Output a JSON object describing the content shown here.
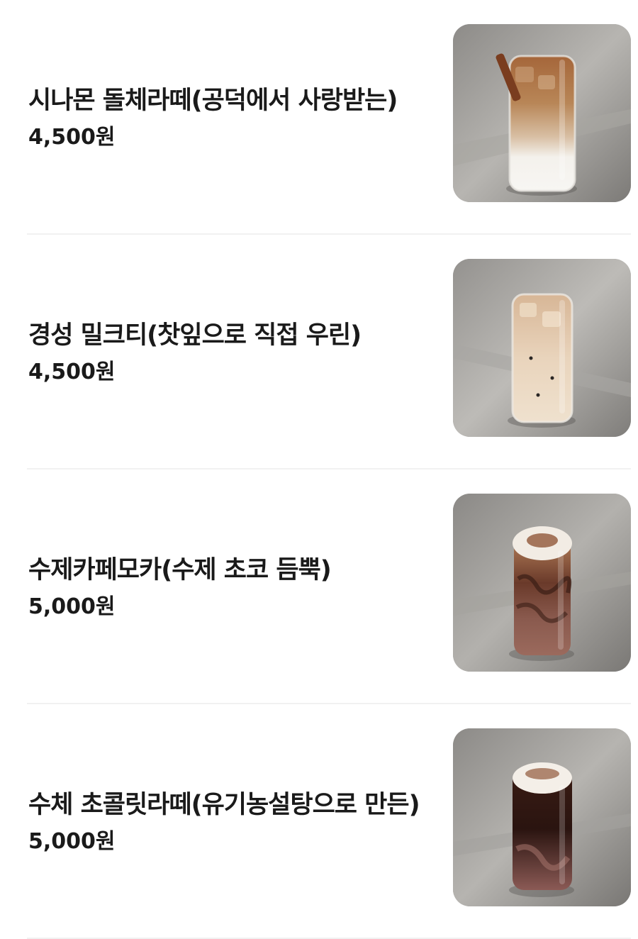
{
  "menu": {
    "items": [
      {
        "name": "시나몬 돌체라떼(공덕에서 사랑받는)",
        "price": "4,500원",
        "image": "cinnamon-dolce-latte-photo"
      },
      {
        "name": "경성 밀크티(찻잎으로 직접 우린)",
        "price": "4,500원",
        "image": "milk-tea-photo"
      },
      {
        "name": "수제카페모카(수제 초코 듬뿍)",
        "price": "5,000원",
        "image": "cafe-mocha-photo"
      },
      {
        "name": "수체 초콜릿라떼(유기농설탕으로 만든)",
        "price": "5,000원",
        "image": "chocolate-latte-photo"
      }
    ]
  },
  "colors": {
    "text": "#1a1a1a",
    "divider": "#f1f1f1",
    "background": "#ffffff"
  }
}
